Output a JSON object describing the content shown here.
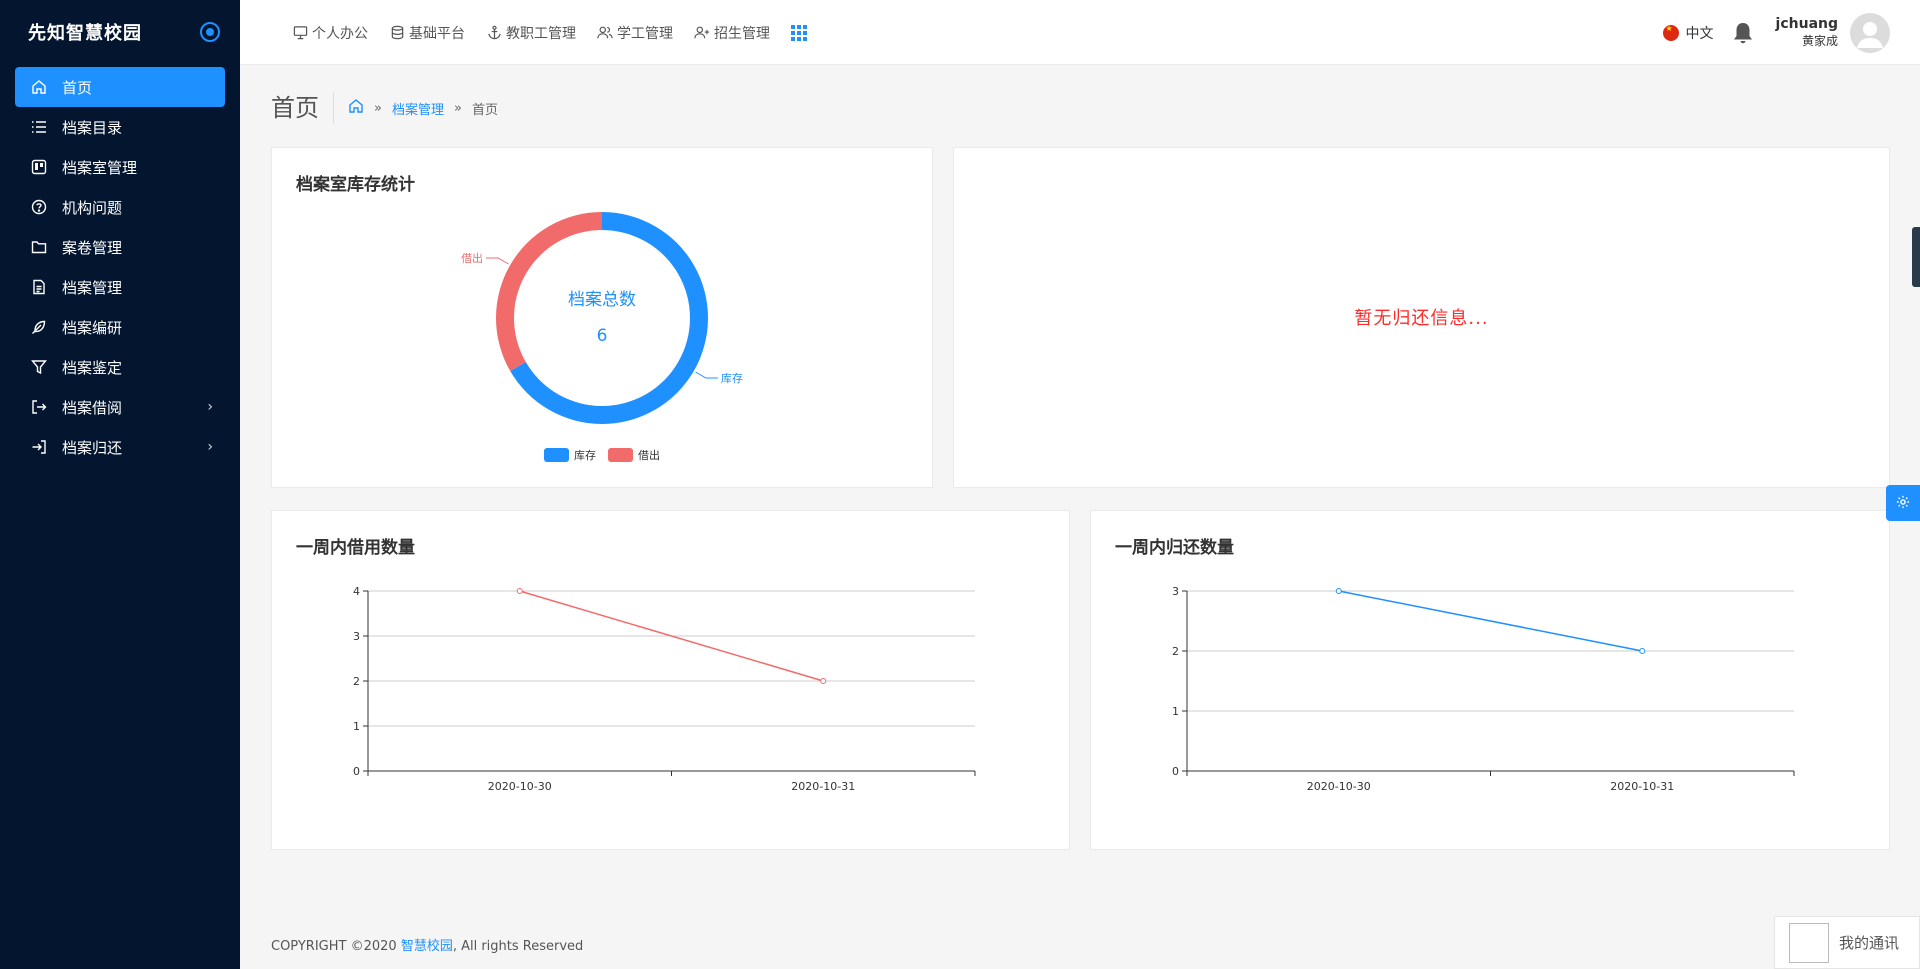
{
  "brand": {
    "title": "先知智慧校园"
  },
  "sidebar": {
    "items": [
      {
        "label": "首页",
        "icon": "home-icon",
        "active": true
      },
      {
        "label": "档案目录",
        "icon": "list-icon"
      },
      {
        "label": "档案室管理",
        "icon": "board-icon"
      },
      {
        "label": "机构问题",
        "icon": "question-circle-icon"
      },
      {
        "label": "案卷管理",
        "icon": "folder-icon"
      },
      {
        "label": "档案管理",
        "icon": "document-icon"
      },
      {
        "label": "档案编研",
        "icon": "feather-icon"
      },
      {
        "label": "档案鉴定",
        "icon": "filter-icon"
      },
      {
        "label": "档案借阅",
        "icon": "logout-icon",
        "expandable": true
      },
      {
        "label": "档案归还",
        "icon": "login-icon",
        "expandable": true
      }
    ]
  },
  "topnav": {
    "items": [
      {
        "label": "个人办公",
        "icon": "monitor-icon"
      },
      {
        "label": "基础平台",
        "icon": "database-icon"
      },
      {
        "label": "教职工管理",
        "icon": "anchor-icon"
      },
      {
        "label": "学工管理",
        "icon": "users-icon"
      },
      {
        "label": "招生管理",
        "icon": "user-plus-icon"
      }
    ]
  },
  "header": {
    "language": "中文",
    "username": "jchuang",
    "realname": "黄家成"
  },
  "page": {
    "title": "首页",
    "breadcrumb": [
      "档案管理",
      "首页"
    ],
    "breadcrumb_sep": "»"
  },
  "cards": {
    "stock_title": "档案室库存统计",
    "return_empty": "暂无归还信息...",
    "borrow_week_title": "一周内借用数量",
    "return_week_title": "一周内归还数量"
  },
  "chart_data": [
    {
      "type": "pie",
      "title": "档案室库存统计",
      "center_label": "档案总数",
      "center_value": "6",
      "slices": [
        {
          "name": "库存",
          "value": 4,
          "color": "#1e90ff"
        },
        {
          "name": "借出",
          "value": 2,
          "color": "#f26b6b"
        }
      ],
      "legend": [
        "库存",
        "借出"
      ],
      "legend_position": "bottom-center"
    },
    {
      "type": "line",
      "title": "一周内借用数量",
      "x": [
        "2020-10-30",
        "2020-10-31"
      ],
      "series": [
        {
          "values": [
            4,
            2
          ],
          "color": "#f26b6b"
        }
      ],
      "ylim": [
        0,
        4
      ],
      "yticks": [
        0,
        1,
        2,
        3,
        4
      ],
      "grid": true
    },
    {
      "type": "line",
      "title": "一周内归还数量",
      "x": [
        "2020-10-30",
        "2020-10-31"
      ],
      "series": [
        {
          "values": [
            3,
            2
          ],
          "color": "#1e90ff"
        }
      ],
      "ylim": [
        0,
        3
      ],
      "yticks": [
        0,
        1,
        2,
        3
      ],
      "grid": true
    }
  ],
  "footer": {
    "prefix": "COPYRIGHT ©2020 ",
    "link": "智慧校园",
    "suffix": ", All rights Reserved"
  },
  "chat": {
    "label": "我的通讯"
  }
}
